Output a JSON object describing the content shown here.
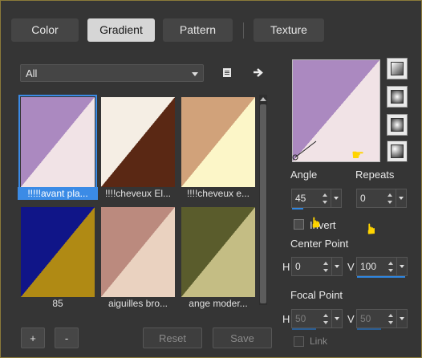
{
  "tabs": [
    {
      "label": "Color",
      "active": false
    },
    {
      "label": "Gradient",
      "active": true
    },
    {
      "label": "Pattern",
      "active": false
    },
    {
      "label": "Texture",
      "active": false
    }
  ],
  "category": {
    "selected": "All"
  },
  "gradients": [
    {
      "label": "!!!!!avant pla...",
      "selected": true,
      "c1": "#ab89c0",
      "c2": "#f1e3e6"
    },
    {
      "label": "!!!!cheveux El...",
      "selected": false,
      "c1": "#f5eee4",
      "c2": "#5a2814"
    },
    {
      "label": "!!!!cheveux e...",
      "selected": false,
      "c1": "#d1a27a",
      "c2": "#fcf6c8"
    },
    {
      "label": "85",
      "selected": false,
      "c1": "#101588",
      "c2": "#b08a14"
    },
    {
      "label": "aiguilles bro...",
      "selected": false,
      "c1": "#bb8a7e",
      "c2": "#ead2c0"
    },
    {
      "label": "ange moder...",
      "selected": false,
      "c1": "#5a5c2c",
      "c2": "#c4bd84"
    }
  ],
  "buttons": {
    "add": "+",
    "remove": "-",
    "reset": "Reset",
    "save": "Save"
  },
  "preview": {
    "c1": "#ab89c0",
    "c2": "#f1e3e6"
  },
  "styles": [
    "linear-icon",
    "radial-icon",
    "rectangular-icon",
    "sunburst-icon"
  ],
  "angle": {
    "label": "Angle",
    "value": "45"
  },
  "repeats": {
    "label": "Repeats",
    "value": "0"
  },
  "invert": {
    "label": "Invert",
    "checked": false
  },
  "center_point": {
    "label": "Center Point",
    "h_label": "H",
    "h_value": "0",
    "v_label": "V",
    "v_value": "100"
  },
  "focal_point": {
    "label": "Focal Point",
    "h_label": "H",
    "h_value": "50",
    "v_label": "V",
    "v_value": "50"
  },
  "link": {
    "label": "Link",
    "checked": false
  },
  "colors": {
    "accent": "#2f86e0",
    "border": "#8a7a3a",
    "pointer": "#ffd400"
  }
}
